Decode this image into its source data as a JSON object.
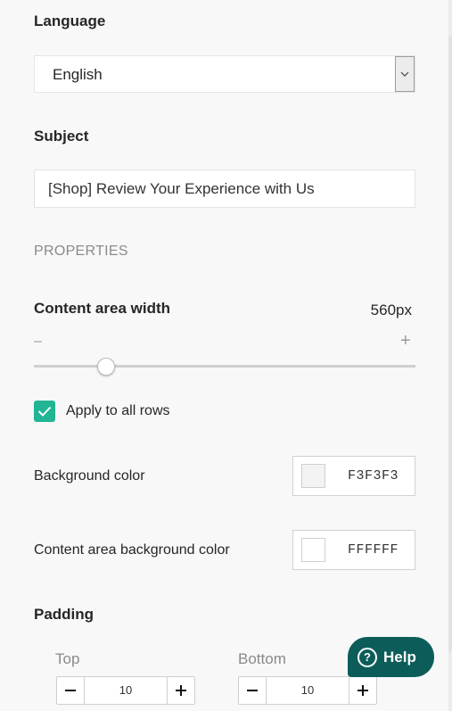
{
  "language": {
    "label": "Language",
    "value": "English"
  },
  "subject": {
    "label": "Subject",
    "value": "[Shop] Review Your Experience with Us"
  },
  "properties": {
    "section_title": "PROPERTIES",
    "content_width": {
      "label": "Content area width",
      "value": "560px",
      "minus": "–",
      "plus": "+",
      "slider_fraction": 0.19
    },
    "apply_all_rows": {
      "label": "Apply to all rows",
      "checked": true
    },
    "background_color": {
      "label": "Background color",
      "hex": "F3F3F3",
      "swatch": "#f3f3f3"
    },
    "content_bg_color": {
      "label": "Content area background color",
      "hex": "FFFFFF",
      "swatch": "#ffffff"
    },
    "padding": {
      "label": "Padding",
      "top": {
        "label": "Top",
        "value": "10"
      },
      "bottom": {
        "label": "Bottom",
        "value": "10"
      }
    }
  },
  "help": {
    "label": "Help",
    "icon": "?"
  },
  "colors": {
    "accent": "#21b495",
    "help_bg": "#0c5d5a"
  }
}
